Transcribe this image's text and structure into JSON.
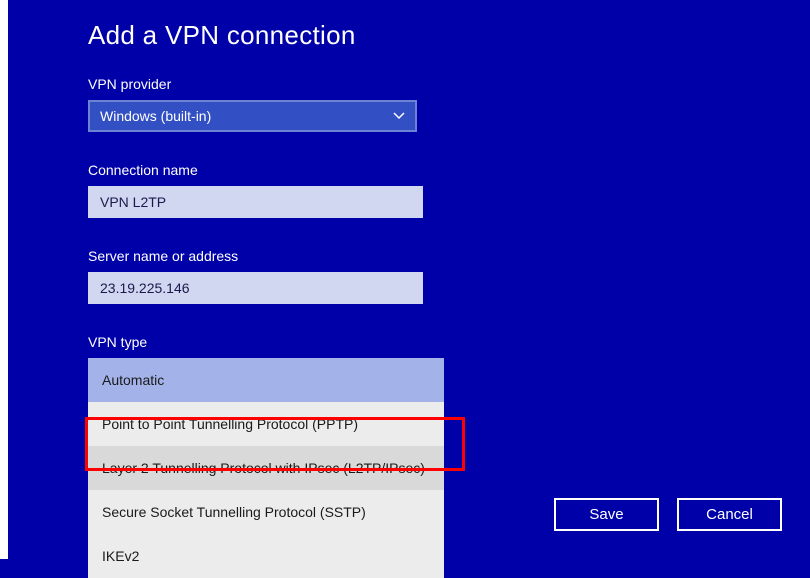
{
  "title": "Add a VPN connection",
  "provider": {
    "label": "VPN provider",
    "selected": "Windows (built-in)"
  },
  "connection_name": {
    "label": "Connection name",
    "value": "VPN L2TP"
  },
  "server": {
    "label": "Server name or address",
    "value": "23.19.225.146"
  },
  "vpn_type": {
    "label": "VPN type",
    "options": [
      "Automatic",
      "Point to Point Tunnelling Protocol (PPTP)",
      "Layer 2 Tunnelling Protocol with IPsec (L2TP/IPsec)",
      "Secure Socket Tunnelling Protocol (SSTP)",
      "IKEv2"
    ]
  },
  "buttons": {
    "save": "Save",
    "cancel": "Cancel"
  }
}
